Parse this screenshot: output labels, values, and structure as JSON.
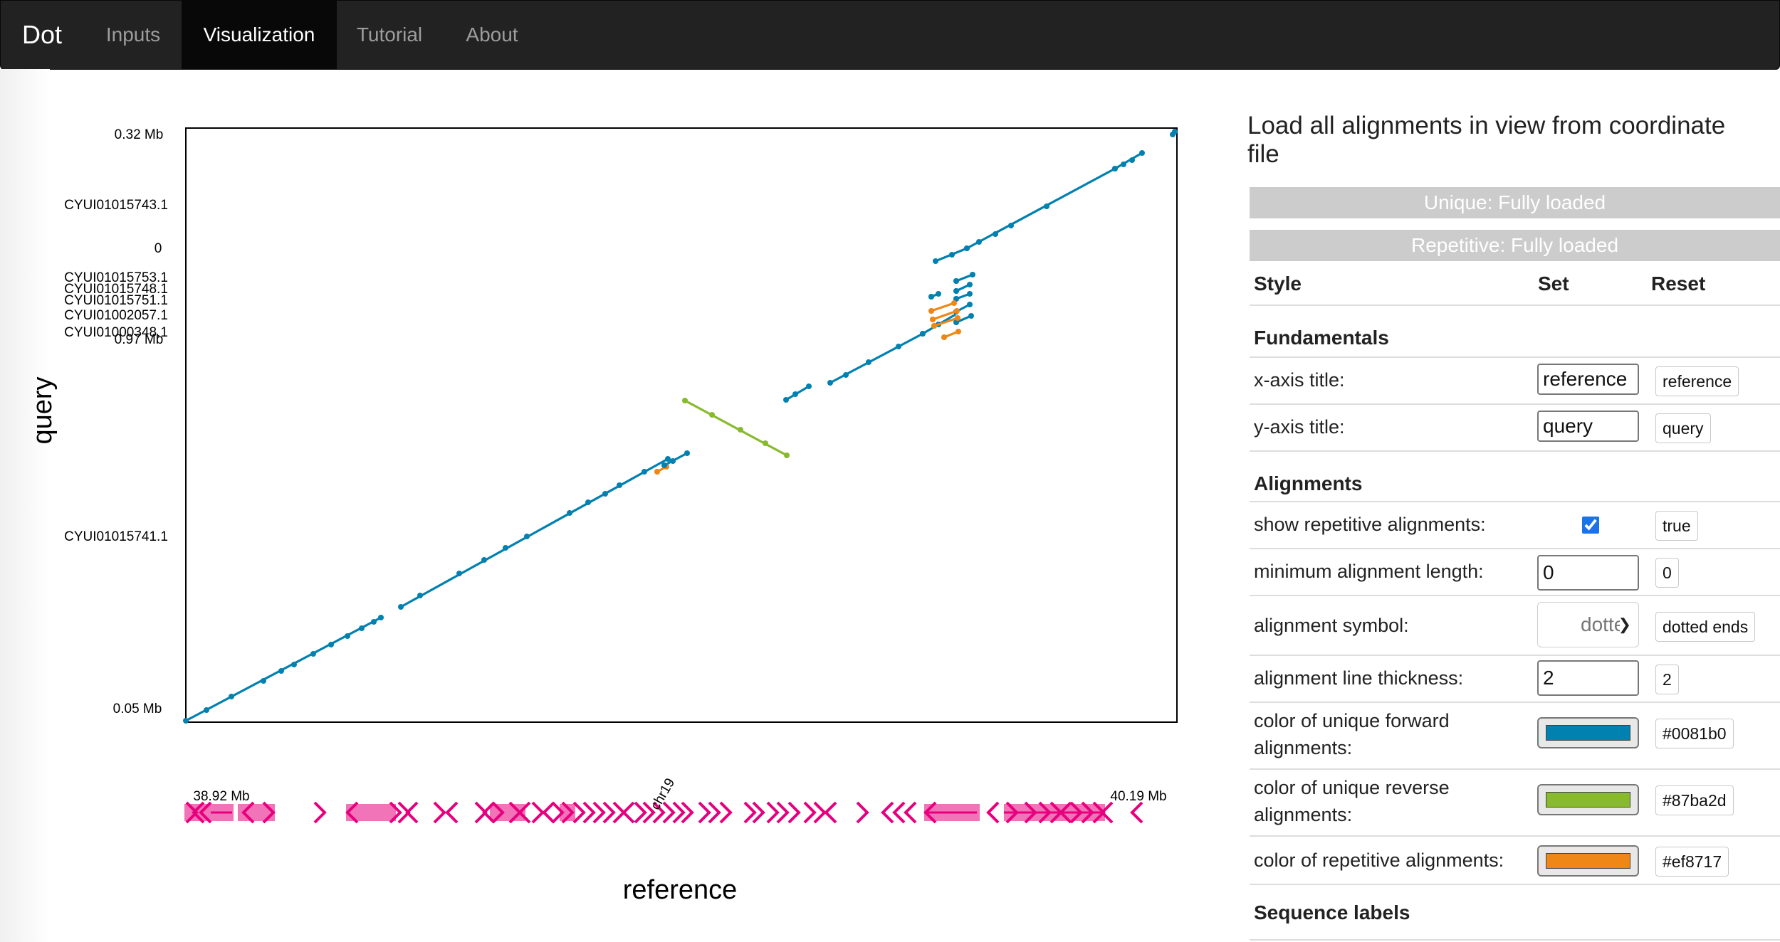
{
  "nav": {
    "brand": "Dot",
    "items": [
      {
        "label": "Inputs",
        "active": false
      },
      {
        "label": "Visualization",
        "active": true
      },
      {
        "label": "Tutorial",
        "active": false
      },
      {
        "label": "About",
        "active": false
      }
    ]
  },
  "plot": {
    "x_axis_title": "reference",
    "y_axis_title": "query",
    "x_ticks": [
      "38.92 Mb",
      "chr19",
      "40.19 Mb"
    ],
    "y_labels": [
      "0.32 Mb",
      "CYUI01015743.1",
      "0",
      "CYUI01015753.1",
      "CYUI01015748.1",
      "CYUI01015751.1",
      "CYUI01002057.1",
      "CYUI01000348.1",
      "0.97 Mb",
      "CYUI01015741.1",
      "0.05 Mb"
    ],
    "colors": {
      "forward": "#0081b0",
      "reverse": "#87ba2d",
      "repetitive": "#ef8717",
      "annotation": "#e6007e"
    }
  },
  "panel": {
    "title": "Load all alignments in view from coordinate file",
    "status": [
      "Unique: Fully loaded",
      "Repetitive: Fully loaded"
    ],
    "headers": {
      "style": "Style",
      "set": "Set",
      "reset": "Reset"
    },
    "sections": {
      "fundamentals": "Fundamentals",
      "alignments": "Alignments",
      "sequence_labels": "Sequence labels"
    },
    "x_axis_title": {
      "label": "x-axis title:",
      "value": "reference",
      "reset": "reference"
    },
    "y_axis_title": {
      "label": "y-axis title:",
      "value": "query",
      "reset": "query"
    },
    "show_repetitive": {
      "label": "show repetitive alignments:",
      "checked": true,
      "reset": "true"
    },
    "min_length": {
      "label": "minimum alignment length:",
      "value": "0",
      "reset": "0"
    },
    "symbol": {
      "label": "alignment symbol:",
      "value": "dotted ends",
      "reset": "dotted ends"
    },
    "thickness": {
      "label": "alignment line thickness:",
      "value": "2",
      "reset": "2"
    },
    "color_forward": {
      "label": "color of unique forward alignments:",
      "value": "#0081b0",
      "reset": "#0081b0"
    },
    "color_reverse": {
      "label": "color of unique reverse alignments:",
      "value": "#87ba2d",
      "reset": "#87ba2d"
    },
    "color_repetitive": {
      "label": "color of repetitive alignments:",
      "value": "#ef8717",
      "reset": "#ef8717"
    }
  }
}
